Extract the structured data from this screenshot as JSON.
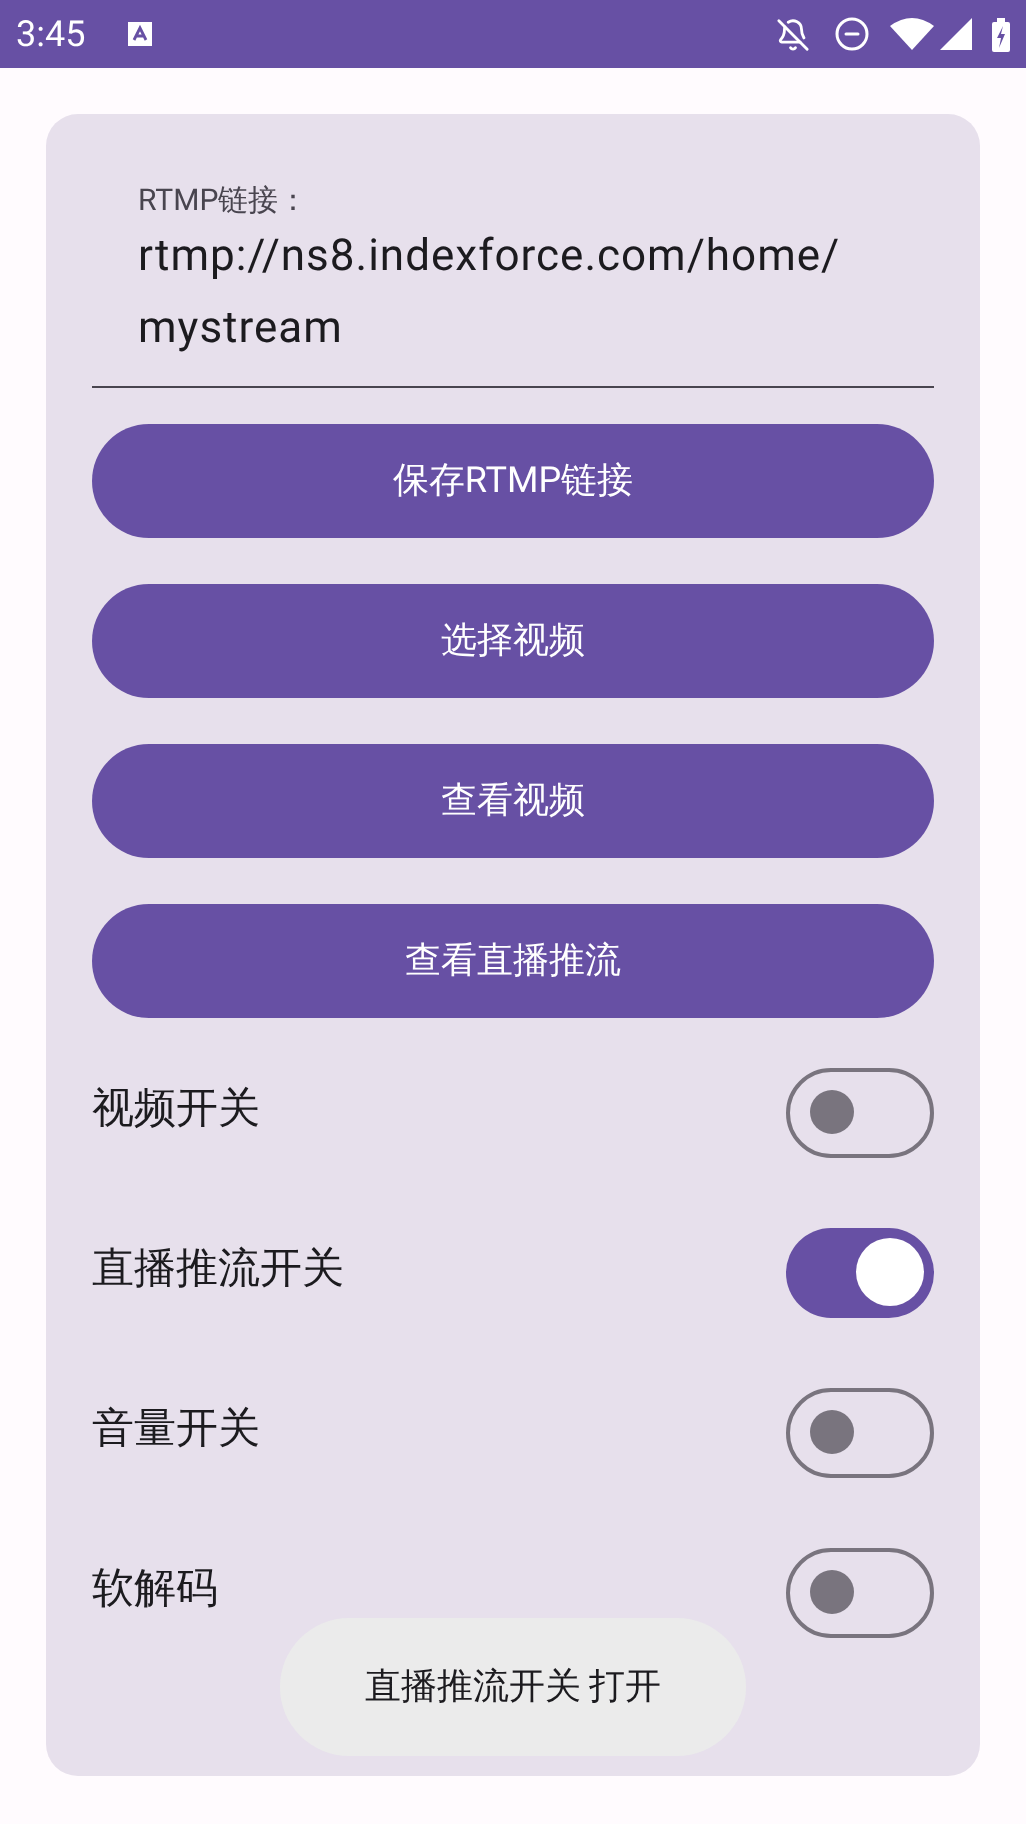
{
  "status_bar": {
    "time": "3:45"
  },
  "rtmp_field": {
    "label": "RTMP链接：",
    "value": "rtmp://ns8.indexforce.com/home/mystream"
  },
  "buttons": [
    "保存RTMP链接",
    "选择视频",
    "查看视频",
    "查看直播推流"
  ],
  "switches": [
    {
      "label": "视频开关",
      "on": false
    },
    {
      "label": "直播推流开关",
      "on": true
    },
    {
      "label": "音量开关",
      "on": false
    },
    {
      "label": "软解码",
      "on": false
    }
  ],
  "toast": "直播推流开关 打开"
}
